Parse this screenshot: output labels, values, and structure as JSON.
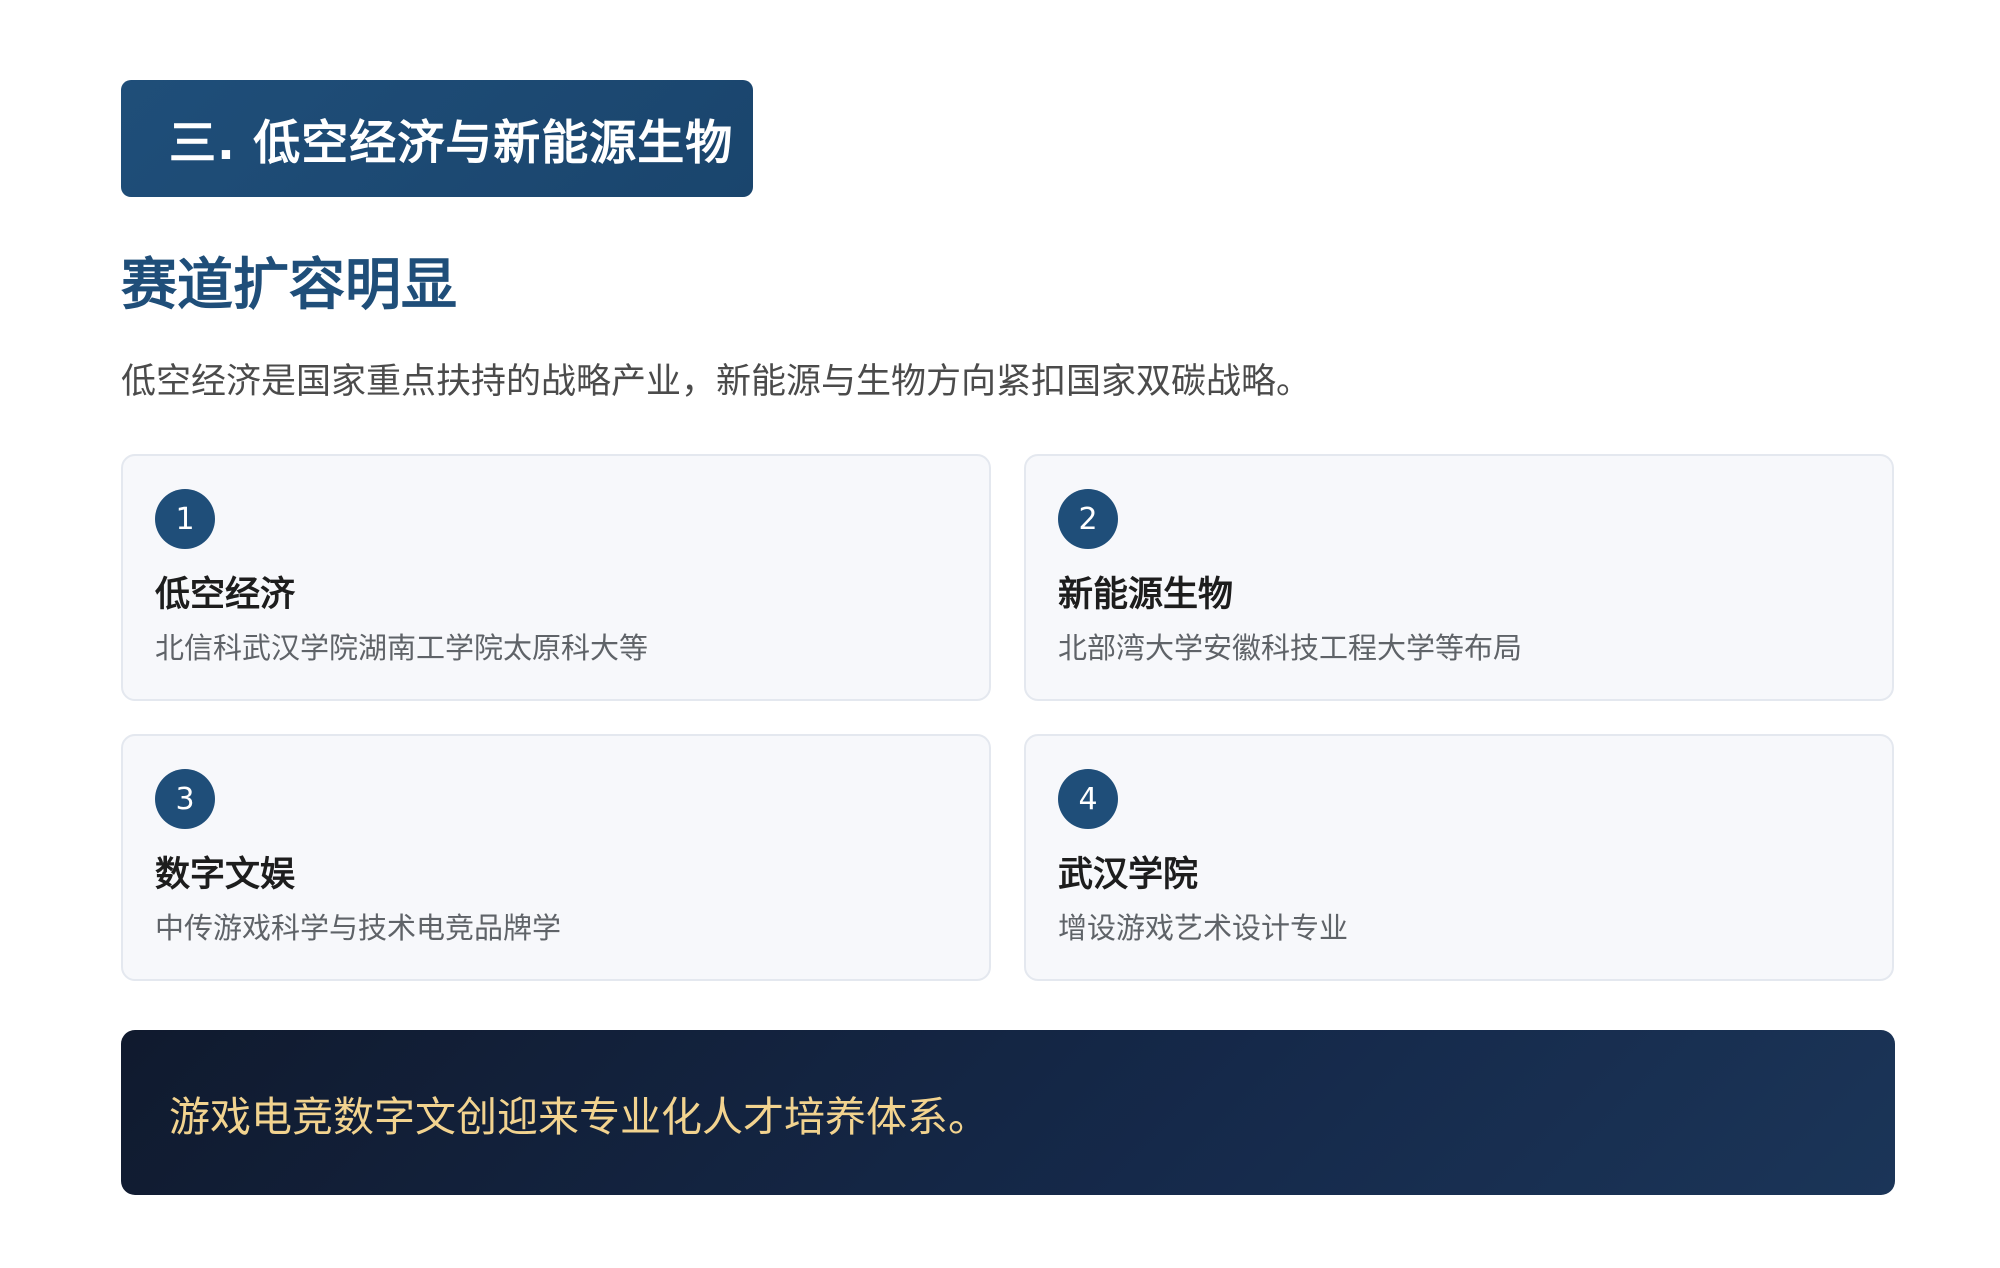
{
  "section": {
    "badge": "三. 低空经济与新能源生物",
    "heading": "赛道扩容明显",
    "intro": "低空经济是国家重点扶持的战略产业，新能源与生物方向紧扣国家双碳战略。"
  },
  "cards": [
    {
      "number": "1",
      "title": "低空经济",
      "description": "北信科武汉学院湖南工学院太原科大等"
    },
    {
      "number": "2",
      "title": "新能源生物",
      "description": "北部湾大学安徽科技工程大学等布局"
    },
    {
      "number": "3",
      "title": "数字文娱",
      "description": "中传游戏科学与技术电竞品牌学"
    },
    {
      "number": "4",
      "title": "武汉学院",
      "description": "增设游戏艺术设计专业"
    }
  ],
  "banner": {
    "text": "游戏电竞数字文创迎来专业化人才培养体系。"
  },
  "colors": {
    "primary": "#1f4e79",
    "banner_bg": "#132440",
    "banner_text": "#f2d38f",
    "card_bg": "#f7f8fb"
  }
}
